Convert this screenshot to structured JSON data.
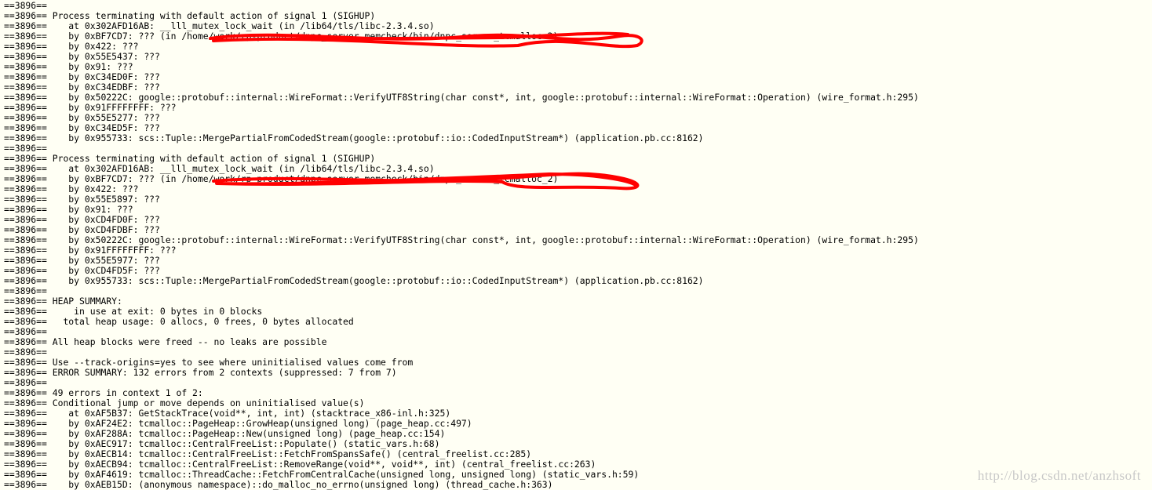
{
  "colors": {
    "background": "#fffff4",
    "text": "#000000",
    "redaction": "#ff0000",
    "watermark": "#c8c8c8"
  },
  "terminal": {
    "pid_prefix": "==3896==",
    "lines": [
      {
        "t": ""
      },
      {
        "t": " Process terminating with default action of signal 1 (SIGHUP)"
      },
      {
        "t": "    at 0x302AFD16AB: __lll_mutex_lock_wait (in /lib64/tls/libc-2.3.4.so)"
      },
      {
        "t": "    by 0xBF7CD7: ??? (in /home/work/rp-product/dnpc_server_memcheck/bin/dnpc_server_tcmalloc_2)"
      },
      {
        "t": "    by 0x422: ???"
      },
      {
        "t": "    by 0x55E5437: ???"
      },
      {
        "t": "    by 0x91: ???"
      },
      {
        "t": "    by 0xC34ED0F: ???"
      },
      {
        "t": "    by 0xC34EDBF: ???"
      },
      {
        "t": "    by 0x50222C: google::protobuf::internal::WireFormat::VerifyUTF8String(char const*, int, google::protobuf::internal::WireFormat::Operation) (wire_format.h:295)"
      },
      {
        "t": "    by 0x91FFFFFFFF: ???"
      },
      {
        "t": "    by 0x55E5277: ???"
      },
      {
        "t": "    by 0xC34ED5F: ???"
      },
      {
        "t": "    by 0x955733: scs::Tuple::MergePartialFromCodedStream(google::protobuf::io::CodedInputStream*) (application.pb.cc:8162)"
      },
      {
        "t": ""
      },
      {
        "t": " Process terminating with default action of signal 1 (SIGHUP)"
      },
      {
        "t": "    at 0x302AFD16AB: __lll_mutex_lock_wait (in /lib64/tls/libc-2.3.4.so)"
      },
      {
        "t": "    by 0xBF7CD7: ??? (in /home/work/rp-product/dnpc_server_memcheck/bin/dnpc_server_tcmalloc_2)"
      },
      {
        "t": "    by 0x422: ???"
      },
      {
        "t": "    by 0x55E5897: ???"
      },
      {
        "t": "    by 0x91: ???"
      },
      {
        "t": "    by 0xCD4FD0F: ???"
      },
      {
        "t": "    by 0xCD4FDBF: ???"
      },
      {
        "t": "    by 0x50222C: google::protobuf::internal::WireFormat::VerifyUTF8String(char const*, int, google::protobuf::internal::WireFormat::Operation) (wire_format.h:295)"
      },
      {
        "t": "    by 0x91FFFFFFFF: ???"
      },
      {
        "t": "    by 0x55E5977: ???"
      },
      {
        "t": "    by 0xCD4FD5F: ???"
      },
      {
        "t": "    by 0x955733: scs::Tuple::MergePartialFromCodedStream(google::protobuf::io::CodedInputStream*) (application.pb.cc:8162)"
      },
      {
        "t": ""
      },
      {
        "t": " HEAP SUMMARY:"
      },
      {
        "t": "     in use at exit: 0 bytes in 0 blocks"
      },
      {
        "t": "   total heap usage: 0 allocs, 0 frees, 0 bytes allocated"
      },
      {
        "t": ""
      },
      {
        "t": " All heap blocks were freed -- no leaks are possible"
      },
      {
        "t": ""
      },
      {
        "t": " Use --track-origins=yes to see where uninitialised values come from"
      },
      {
        "t": " ERROR SUMMARY: 132 errors from 2 contexts (suppressed: 7 from 7)"
      },
      {
        "t": "",
        "nospace": true
      },
      {
        "t": " 49 errors in context 1 of 2:"
      },
      {
        "t": " Conditional jump or move depends on uninitialised value(s)"
      },
      {
        "t": "    at 0xAF5B37: GetStackTrace(void**, int, int) (stacktrace_x86-inl.h:325)"
      },
      {
        "t": "    by 0xAF24E2: tcmalloc::PageHeap::GrowHeap(unsigned long) (page_heap.cc:497)"
      },
      {
        "t": "    by 0xAF288A: tcmalloc::PageHeap::New(unsigned long) (page_heap.cc:154)"
      },
      {
        "t": "    by 0xAEC917: tcmalloc::CentralFreeList::Populate() (static_vars.h:68)"
      },
      {
        "t": "    by 0xAECB14: tcmalloc::CentralFreeList::FetchFromSpansSafe() (central_freelist.cc:285)"
      },
      {
        "t": "    by 0xAECB94: tcmalloc::CentralFreeList::RemoveRange(void**, void**, int) (central_freelist.cc:263)"
      },
      {
        "t": "    by 0xAF4619: tcmalloc::ThreadCache::FetchFromCentralCache(unsigned long, unsigned long) (static_vars.h:59)"
      },
      {
        "t": "    by 0xAEB15D: (anonymous namespace)::do_malloc_no_errno(unsigned long) (thread_cache.h:363)"
      }
    ]
  },
  "watermark": "http://blog.csdn.net/anzhsoft"
}
